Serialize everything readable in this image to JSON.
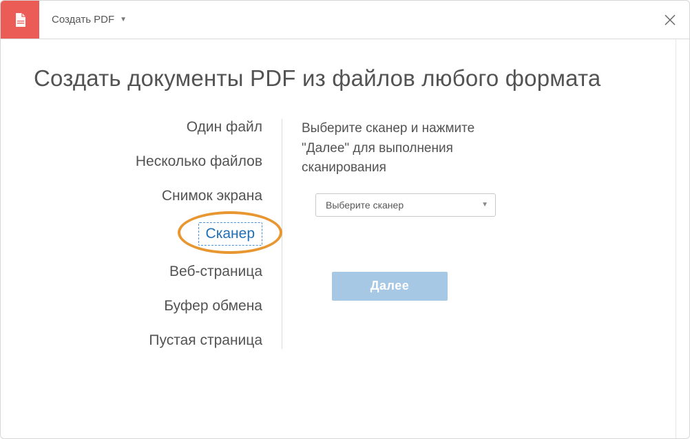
{
  "header": {
    "menu_label": "Создать PDF"
  },
  "page_title": "Создать документы PDF из файлов любого формата",
  "options": [
    "Один файл",
    "Несколько файлов",
    "Снимок экрана",
    "Сканер",
    "Веб-страница",
    "Буфер обмена",
    "Пустая страница"
  ],
  "selected_index": 3,
  "right_panel": {
    "instruction": "Выберите сканер и нажмите \"Далее\" для выполнения сканирования",
    "select_placeholder": "Выберите сканер",
    "next_button": "Далее"
  }
}
